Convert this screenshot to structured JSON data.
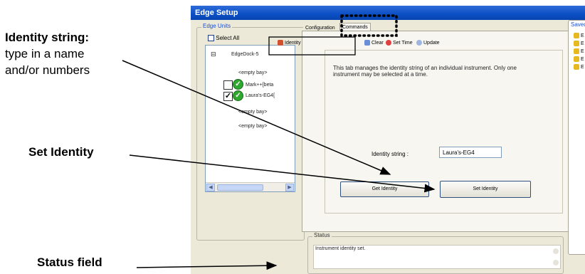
{
  "annotations": {
    "identity_title": "Identity string:",
    "identity_desc_1": "type in a name",
    "identity_desc_2": "and/or numbers",
    "set_identity": "Set Identity",
    "status_field": "Status field"
  },
  "window": {
    "title": "Edge Setup",
    "edge_units": {
      "legend": "Edge Units",
      "select_all": "Select All",
      "tree": {
        "dock": "EdgeDock-5",
        "bays": [
          "<empty bay>",
          "Mark++[beta",
          "Laura's-EG4[",
          "<empty bay>",
          "<empty bay>"
        ]
      }
    },
    "tabs": {
      "configuration": "Configuration",
      "commands": "Commands"
    },
    "subtabs": {
      "identity": "Identity",
      "clear": "Clear",
      "set_time": "Set Time",
      "update": "Update"
    },
    "identity_panel": {
      "description": "This tab manages the identity string of an individual instrument.  Only one instrument may be selected at a time.",
      "identity_label": "Identity string :",
      "identity_value": "Laura's-EG4",
      "get_button": "Get Identity",
      "set_button": "Set Identity"
    },
    "status": {
      "legend": "Status",
      "text": "Instrument identity set."
    },
    "saved": {
      "legend": "Saved",
      "items": [
        "E",
        "E",
        "E",
        "E",
        "E"
      ]
    }
  }
}
